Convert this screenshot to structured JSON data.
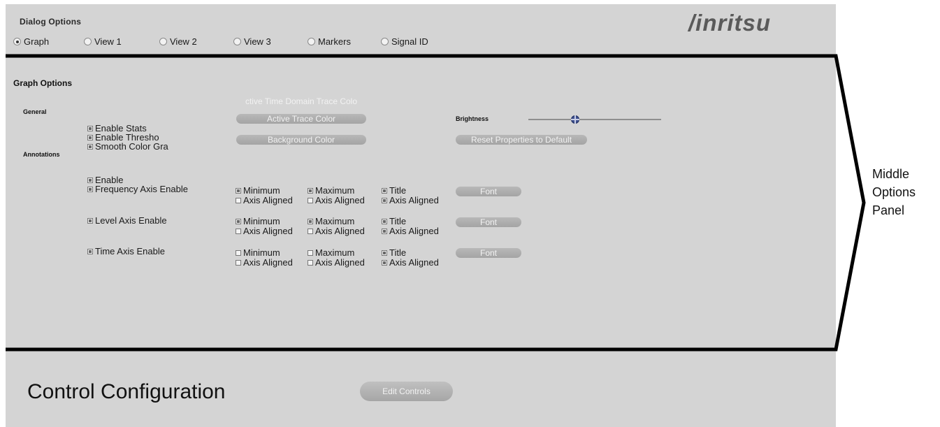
{
  "dialog": {
    "title": "Dialog Options",
    "logo": "/inritsu",
    "radios": [
      {
        "label": "Graph",
        "selected": true
      },
      {
        "label": "View 1",
        "selected": false
      },
      {
        "label": "View 2",
        "selected": false
      },
      {
        "label": "View 3",
        "selected": false
      },
      {
        "label": "Markers",
        "selected": false
      },
      {
        "label": "Signal ID",
        "selected": false
      }
    ]
  },
  "graph_options": {
    "title": "Graph Options",
    "general_label": "General",
    "annotations_label": "Annotations",
    "general_checks": [
      {
        "label": "Enable Stats",
        "checked": true
      },
      {
        "label": "Enable Thresho",
        "checked": true
      },
      {
        "label": "Smooth Color Gra",
        "checked": true
      }
    ],
    "color_buttons": {
      "time_domain": "ctive Time Domain Trace Colo",
      "active_trace": "Active Trace Color",
      "background": "Background Color",
      "reset": "Reset Properties to Default"
    },
    "brightness_label": "Brightness",
    "brightness_level": 0.35,
    "annotations_enable": {
      "label": "Enable",
      "checked": true
    },
    "axes": [
      {
        "label": "Frequency Axis Enable",
        "checked": true,
        "minimum": {
          "label": "Minimum",
          "checked": true
        },
        "maximum": {
          "label": "Maximum",
          "checked": true
        },
        "title": {
          "label": "Title",
          "checked": true
        },
        "min_aligned": {
          "label": "Axis Aligned",
          "checked": false
        },
        "max_aligned": {
          "label": "Axis Aligned",
          "checked": false
        },
        "title_aligned": {
          "label": "Axis Aligned",
          "checked": true
        },
        "font": "Font"
      },
      {
        "label": "Level Axis Enable",
        "checked": true,
        "minimum": {
          "label": "Minimum",
          "checked": true
        },
        "maximum": {
          "label": "Maximum",
          "checked": true
        },
        "title": {
          "label": "Title",
          "checked": true
        },
        "min_aligned": {
          "label": "Axis Aligned",
          "checked": false
        },
        "max_aligned": {
          "label": "Axis Aligned",
          "checked": false
        },
        "title_aligned": {
          "label": "Axis Aligned",
          "checked": true
        },
        "font": "Font"
      },
      {
        "label": "Time Axis Enable",
        "checked": true,
        "minimum": {
          "label": "Minimum",
          "checked": false
        },
        "maximum": {
          "label": "Maximum",
          "checked": false
        },
        "title": {
          "label": "Title",
          "checked": true
        },
        "min_aligned": {
          "label": "Axis Aligned",
          "checked": false
        },
        "max_aligned": {
          "label": "Axis Aligned",
          "checked": false
        },
        "title_aligned": {
          "label": "Axis Aligned",
          "checked": true
        },
        "font": "Font"
      }
    ]
  },
  "control": {
    "title": "Control Configuration",
    "edit_button": "Edit Controls"
  },
  "callout": {
    "line1": "Middle",
    "line2": "Options",
    "line3": "Panel"
  }
}
